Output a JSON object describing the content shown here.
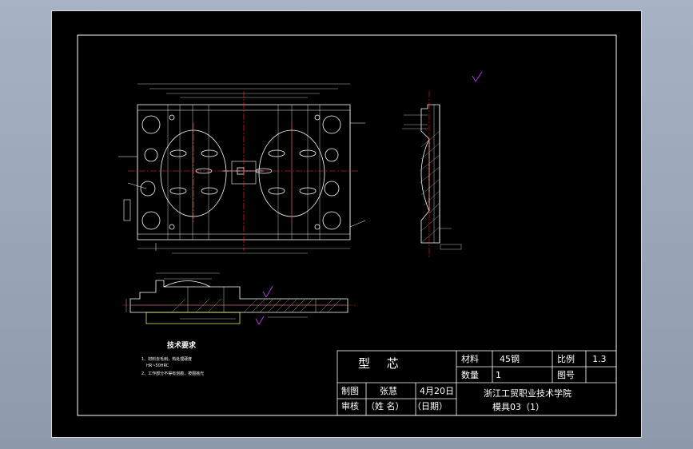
{
  "title_block": {
    "part_name": "型 芯",
    "material_label": "材料",
    "material_value": "45钢",
    "scale_label": "比例",
    "scale_value": "1.3",
    "quantity_label": "数量",
    "quantity_value": "1",
    "drawing_no_label": "图号",
    "drawn_label": "制图",
    "drawn_name": "张慧",
    "drawn_date": "4月20日",
    "checked_label": "审核",
    "name_placeholder": "（姓  名）",
    "date_placeholder": "（日期）",
    "school": "浙江工贸职业技术学院",
    "class": "模具03（1）"
  },
  "tech_requirements": {
    "title": "技术要求",
    "lines": [
      "1、材料去毛刺，热处理硬度",
      "HR~50HRC",
      "2、工作部分不得有划痕，按图抛光"
    ]
  },
  "colors": {
    "outline": "#ffffff",
    "center": "#ff3333",
    "dim": "#d0d0d0",
    "accent": "#cc44ff",
    "yellow": "#ffff66"
  }
}
